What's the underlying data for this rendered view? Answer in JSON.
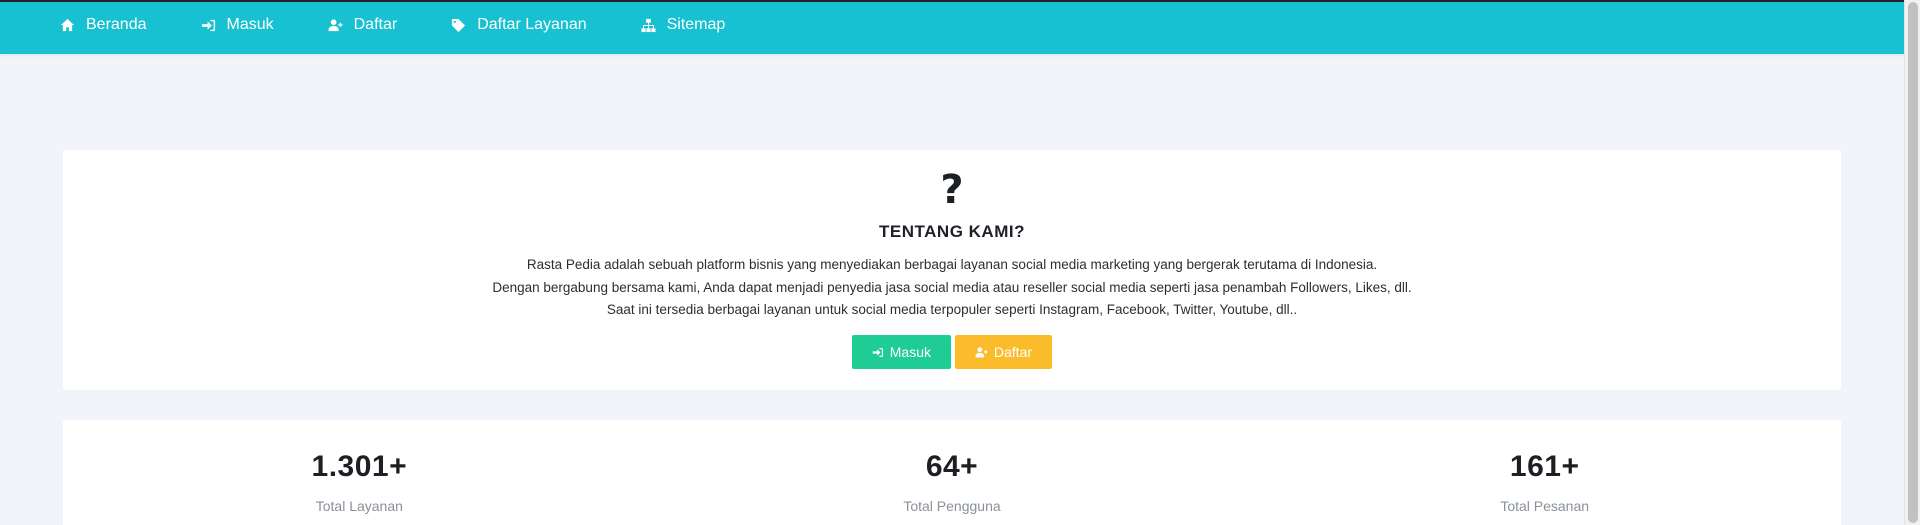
{
  "nav": {
    "items": [
      {
        "label": "Beranda",
        "icon": "home-icon"
      },
      {
        "label": "Masuk",
        "icon": "sign-in-icon"
      },
      {
        "label": "Daftar",
        "icon": "user-plus-icon"
      },
      {
        "label": "Daftar Layanan",
        "icon": "tag-icon"
      },
      {
        "label": "Sitemap",
        "icon": "sitemap-icon"
      }
    ]
  },
  "about": {
    "icon": "question-icon",
    "icon_glyph": "?",
    "title": "TENTANG KAMI?",
    "lines": [
      "Rasta Pedia adalah sebuah platform bisnis yang menyediakan berbagai layanan social media marketing yang bergerak terutama di Indonesia.",
      "Dengan bergabung bersama kami, Anda dapat menjadi penyedia jasa social media atau reseller social media seperti jasa penambah Followers, Likes, dll.",
      "Saat ini tersedia berbagai layanan untuk social media terpopuler seperti Instagram, Facebook, Twitter, Youtube, dll.."
    ],
    "buttons": {
      "login_label": "Masuk",
      "register_label": "Daftar"
    }
  },
  "stats": [
    {
      "value": "1.301+",
      "label": "Total Layanan"
    },
    {
      "value": "64+",
      "label": "Total Pengguna"
    },
    {
      "value": "161+",
      "label": "Total Pesanan"
    }
  ],
  "colors": {
    "navbar": "#17c1d1",
    "background": "#f1f4f8",
    "btn_login": "#1fcc94",
    "btn_register": "#fbbc2c"
  }
}
